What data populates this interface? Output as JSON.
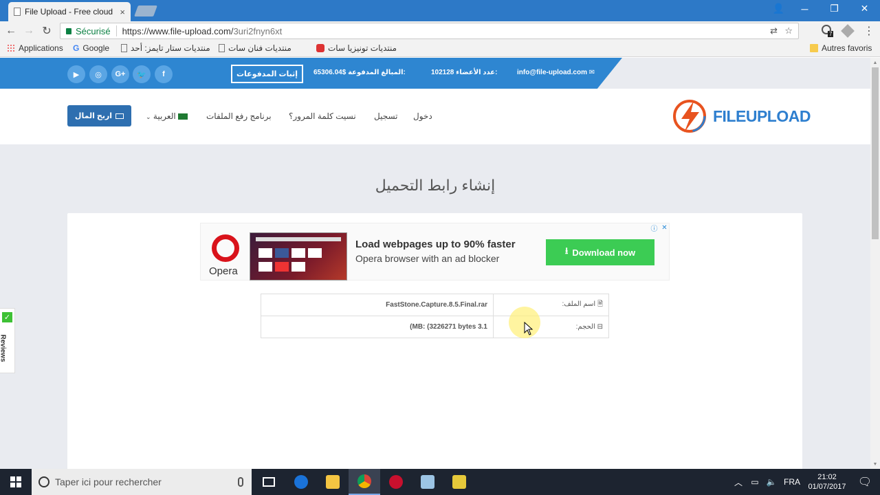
{
  "browser": {
    "tab_title": "File Upload - Free cloud",
    "tab_close": "×",
    "window_controls": {
      "profile": "👤",
      "minimize": "─",
      "restore": "❐",
      "close": "✕"
    },
    "secure_label": "Sécurisé",
    "url_host": "https://www.file-upload.com/",
    "url_path": "3uri2fnyn6xt",
    "extension_badge": "7"
  },
  "bookmarks": {
    "apps": "Applications",
    "items": [
      "Google",
      "منتديات ستار تايمز: أحد",
      "منتديات فنان سات",
      "منتديات تونيزيا سات"
    ],
    "other": "Autres favoris"
  },
  "topbar": {
    "social": [
      "▶",
      "◎",
      "G+",
      "🐦",
      "f"
    ],
    "proof_button": "إثبات المدفوعات",
    "paid_amount": "65306.04$ المبالغ المدفوعة:",
    "members": "102128 عدد الأعضاء:",
    "email": "info@file-upload.com"
  },
  "header": {
    "earn_button": "اربح المال",
    "nav": [
      "دخول",
      "تسجيل",
      "نسيت كلمة المرور؟",
      "برنامج رفع الملفات",
      "العربية"
    ],
    "logo_text": "FILEUPLOAD"
  },
  "page_title": "إنشاء رابط التحميل",
  "ad": {
    "brand": "Opera",
    "headline": "Load webpages up to 90% faster",
    "subline": "Opera browser with an ad blocker",
    "download": "Download now",
    "info": "ⓘ",
    "close": "✕"
  },
  "file_info": {
    "rows": [
      {
        "label": "اسم الملف:",
        "value": "FastStone.Capture.8.5.Final.rar"
      },
      {
        "label": "الحجم:",
        "value": "(MB: (3226271 bytes 3.1"
      }
    ]
  },
  "reviews_label": "Reviews",
  "taskbar": {
    "search_placeholder": "Taper ici pour rechercher",
    "lang": "FRA",
    "time": "21:02",
    "date": "01/07/2017"
  },
  "colors": {
    "chrome_blue": "#2d79c7",
    "topbar_blue": "#2e86d1",
    "earn_button": "#2e6fb0",
    "download_green": "#3ccc54",
    "opera_red": "#d9131b",
    "page_bg": "#e9ebf0"
  }
}
